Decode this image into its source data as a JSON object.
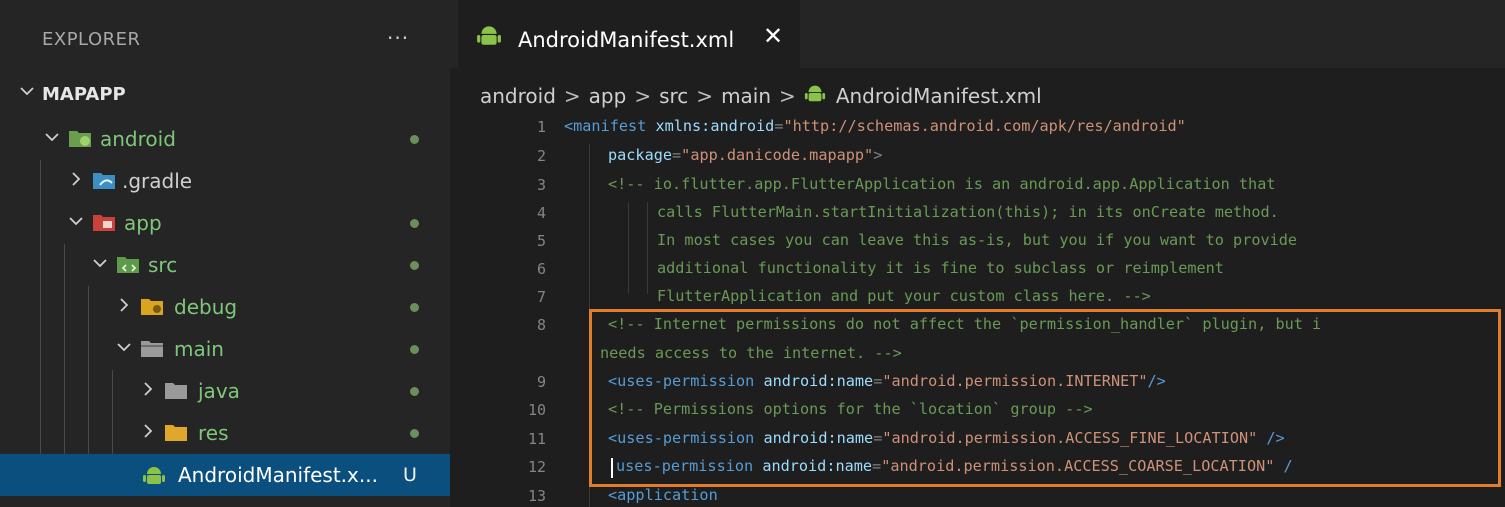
{
  "sidebar": {
    "title": "EXPLORER",
    "more_label": "···",
    "section_label": "MAPAPP",
    "items": [
      {
        "label": "android",
        "status": "dot"
      },
      {
        "label": ".gradle",
        "status": ""
      },
      {
        "label": "app",
        "status": "dot"
      },
      {
        "label": "src",
        "status": "dot"
      },
      {
        "label": "debug",
        "status": "dot"
      },
      {
        "label": "main",
        "status": "dot"
      },
      {
        "label": "java",
        "status": "dot"
      },
      {
        "label": "res",
        "status": "dot"
      },
      {
        "label": "AndroidManifest.x...",
        "status": "U"
      }
    ]
  },
  "tab": {
    "label": "AndroidManifest.xml",
    "close_glyph": "✕"
  },
  "breadcrumb": {
    "parts": [
      "android",
      "app",
      "src",
      "main"
    ],
    "file": "AndroidManifest.xml",
    "separator": ">"
  },
  "code": {
    "lines": [
      {
        "n": "1"
      },
      {
        "n": "2"
      },
      {
        "n": "3"
      },
      {
        "n": "4"
      },
      {
        "n": "5"
      },
      {
        "n": "6"
      },
      {
        "n": "7"
      },
      {
        "n": "8"
      },
      {
        "n": ""
      },
      {
        "n": "9"
      },
      {
        "n": "10"
      },
      {
        "n": "11"
      },
      {
        "n": "12"
      },
      {
        "n": "13"
      }
    ],
    "l1_open": "<manifest",
    "l1_attr": "xmlns:android",
    "l1_eq": "=",
    "l1_val": "\"http://schemas.android.com/apk/res/android\"",
    "l2_attr": "package",
    "l2_eq": "=",
    "l2_val": "\"app.danicode.mapapp\"",
    "l2_close": ">",
    "l3": "<!-- io.flutter.app.FlutterApplication is an android.app.Application that",
    "l4": "calls FlutterMain.startInitialization(this); in its onCreate method.",
    "l5": "In most cases you can leave this as-is, but you if you want to provide",
    "l6": "additional functionality it is fine to subclass or reimplement",
    "l7": "FlutterApplication and put your custom class here. -->",
    "l8": "<!-- Internet permissions do not affect the `permission_handler` plugin, but i",
    "l8b": "needs access to the internet. -->",
    "l9_tag": "<uses-permission",
    "l9_attr": "android:name",
    "l9_eq": "=",
    "l9_val": "\"android.permission.INTERNET\"",
    "l9_close": "/>",
    "l10": "<!-- Permissions options for the `location` group -->",
    "l11_tag": "<uses-permission",
    "l11_attr": "android:name",
    "l11_eq": "=",
    "l11_val": "\"android.permission.ACCESS_FINE_LOCATION\"",
    "l11_close": "/>",
    "l12_tag": "uses-permission",
    "l12_attr": "android:name",
    "l12_eq": "=",
    "l12_val": "\"android.permission.ACCESS_COARSE_LOCATION\"",
    "l12_close": "/",
    "l13": "<application"
  },
  "colors": {
    "highlight": "#e27d2c",
    "selection": "#0b4f7f"
  }
}
